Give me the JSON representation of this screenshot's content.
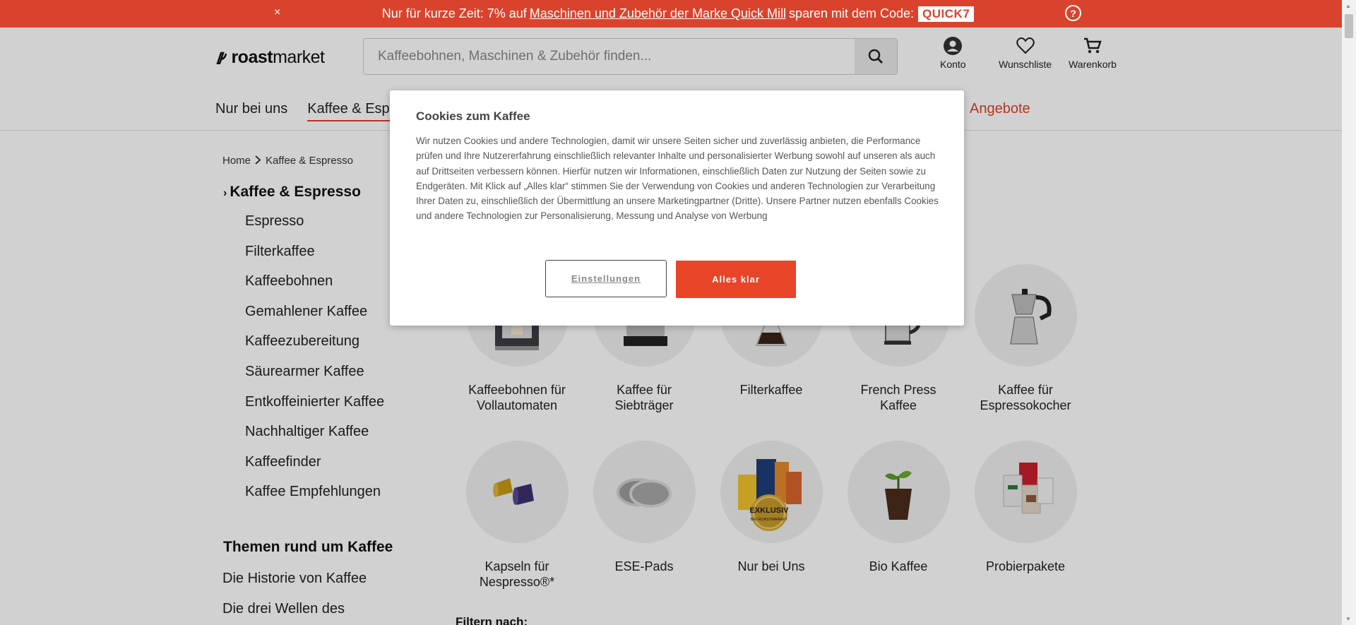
{
  "promo": {
    "close": "×",
    "text_before": "Nur für kurze Zeit: 7% auf",
    "link": "Maschinen und Zubehör der Marke Quick Mill",
    "text_after": "sparen mit dem Code:",
    "code": "QUICK7",
    "help": "?"
  },
  "header": {
    "logo_bold": "roast",
    "logo_rest": "market",
    "search_placeholder": "Kaffeebohnen, Maschinen & Zubehör finden...",
    "account": "Konto",
    "wishlist": "Wunschliste",
    "cart": "Warenkorb"
  },
  "nav": {
    "items": [
      "Nur bei uns",
      "Kaffee & Espresso"
    ],
    "offers": "Angebote"
  },
  "breadcrumb": {
    "home": "Home",
    "current": "Kaffee & Espresso"
  },
  "sidebar": {
    "heading": "Kaffee & Espresso",
    "items": [
      "Espresso",
      "Filterkaffee",
      "Kaffeebohnen",
      "Gemahlener Kaffee",
      "Kaffeezubereitung",
      "Säurearmer Kaffee",
      "Entkoffeinierter Kaffee",
      "Nachhaltiger Kaffee",
      "Kaffeefinder",
      "Kaffee Empfehlungen"
    ],
    "topics_heading": "Themen rund um Kaffee",
    "topics": [
      "Die Historie von Kaffee",
      "Die drei Wellen des"
    ]
  },
  "categories": [
    {
      "line1": "Kaffeebohnen für",
      "line2": "Vollautomaten",
      "icon": "espresso-machine-icon"
    },
    {
      "line1": "Kaffee für",
      "line2": "Siebträger",
      "icon": "portafilter-machine-icon"
    },
    {
      "line1": "Filterkaffee",
      "line2": "",
      "icon": "chemex-icon"
    },
    {
      "line1": "French Press",
      "line2": "Kaffee",
      "icon": "french-press-icon"
    },
    {
      "line1": "Kaffee für",
      "line2": "Espressokocher",
      "icon": "moka-pot-icon"
    },
    {
      "line1": "Kapseln für",
      "line2": "Nespresso®*",
      "icon": "capsule-icon"
    },
    {
      "line1": "ESE-Pads",
      "line2": "",
      "icon": "pads-icon"
    },
    {
      "line1": "Nur bei Uns",
      "line2": "",
      "icon": "exclusive-bags-icon",
      "badge_line1": "EXKLUSIV",
      "badge_line2": "BEI ROASTMARKET"
    },
    {
      "line1": "Bio Kaffee",
      "line2": "",
      "icon": "plant-icon"
    },
    {
      "line1": "Probierpakete",
      "line2": "",
      "icon": "sample-pack-icon"
    }
  ],
  "filter_label": "Filtern nach:",
  "cookie": {
    "title": "Cookies zum Kaffee",
    "body": "Wir nutzen Cookies und andere Technologien, damit wir unsere Seiten sicher und zuverlässig anbieten, die Performance prüfen und Ihre Nutzererfahrung einschließlich relevanter Inhalte und personalisierter Werbung sowohl auf unseren als auch auf Drittseiten verbessern können. Hierfür nutzen wir Informationen, einschließlich Daten zur Nutzung der Seiten sowie zu Endgeräten. Mit Klick auf „Alles klar“ stimmen Sie der Verwendung von Cookies und anderen Technologien zur Verarbeitung Ihrer Daten zu, einschließlich der Übermittlung an unsere Marketingpartner (Dritte). Unsere Partner nutzen ebenfalls Cookies und andere Technologien zur Personalisierung, Messung und Analyse von Werbung",
    "settings": "Einstellungen",
    "accept": "Alles klar"
  },
  "colors": {
    "accent": "#d9432d",
    "accept_button": "#e84428"
  }
}
